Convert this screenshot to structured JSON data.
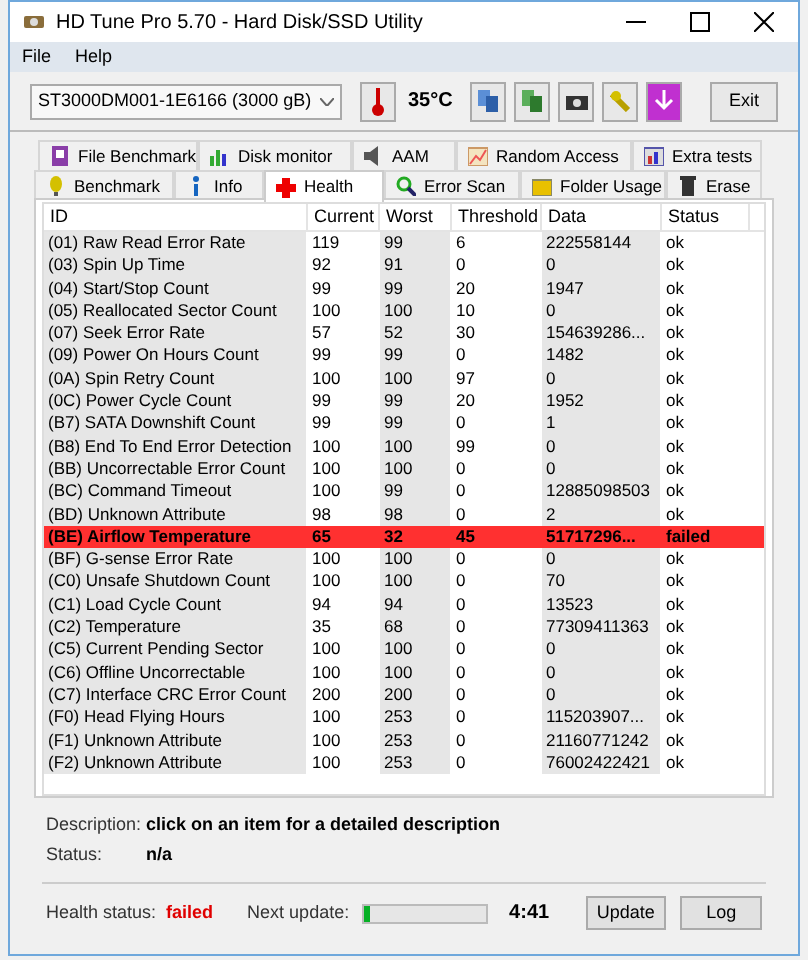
{
  "window": {
    "title": "HD Tune Pro 5.70 - Hard Disk/SSD Utility"
  },
  "menu": [
    "File",
    "Help"
  ],
  "drive": {
    "value": "ST3000DM001-1E6166 (3000 gB)"
  },
  "temperature": "35°C",
  "exit_button": "Exit",
  "tabs_top": [
    {
      "label": "File Benchmark",
      "selected": false
    },
    {
      "label": "Disk monitor",
      "selected": false
    },
    {
      "label": "AAM",
      "selected": false
    },
    {
      "label": "Random Access",
      "selected": false
    },
    {
      "label": "Extra tests",
      "selected": false
    }
  ],
  "tabs_bottom": [
    {
      "label": "Benchmark",
      "selected": false
    },
    {
      "label": "Info",
      "selected": false
    },
    {
      "label": "Health",
      "selected": true
    },
    {
      "label": "Error Scan",
      "selected": false
    },
    {
      "label": "Folder Usage",
      "selected": false
    },
    {
      "label": "Erase",
      "selected": false
    }
  ],
  "table": {
    "columns": [
      "ID",
      "Current",
      "Worst",
      "Threshold",
      "Data",
      "Status"
    ],
    "rows": [
      {
        "cells": [
          "(01) Raw Read Error Rate",
          "119",
          "99",
          "6",
          "222558144",
          "ok"
        ],
        "failed": false
      },
      {
        "cells": [
          "(03) Spin Up Time",
          "92",
          "91",
          "0",
          "0",
          "ok"
        ],
        "failed": false
      },
      {
        "cells": [
          "(04) Start/Stop Count",
          "99",
          "99",
          "20",
          "1947",
          "ok"
        ],
        "failed": false
      },
      {
        "cells": [
          "(05) Reallocated Sector Count",
          "100",
          "100",
          "10",
          "0",
          "ok"
        ],
        "failed": false
      },
      {
        "cells": [
          "(07) Seek Error Rate",
          "57",
          "52",
          "30",
          "154639286...",
          "ok"
        ],
        "failed": false
      },
      {
        "cells": [
          "(09) Power On Hours Count",
          "99",
          "99",
          "0",
          "1482",
          "ok"
        ],
        "failed": false
      },
      {
        "cells": [
          "(0A) Spin Retry Count",
          "100",
          "100",
          "97",
          "0",
          "ok"
        ],
        "failed": false
      },
      {
        "cells": [
          "(0C) Power Cycle Count",
          "99",
          "99",
          "20",
          "1952",
          "ok"
        ],
        "failed": false
      },
      {
        "cells": [
          "(B7) SATA Downshift Count",
          "99",
          "99",
          "0",
          "1",
          "ok"
        ],
        "failed": false
      },
      {
        "cells": [
          "(B8) End To End Error Detection",
          "100",
          "100",
          "99",
          "0",
          "ok"
        ],
        "failed": false
      },
      {
        "cells": [
          "(BB) Uncorrectable Error Count",
          "100",
          "100",
          "0",
          "0",
          "ok"
        ],
        "failed": false
      },
      {
        "cells": [
          "(BC) Command Timeout",
          "100",
          "99",
          "0",
          "12885098503",
          "ok"
        ],
        "failed": false
      },
      {
        "cells": [
          "(BD) Unknown Attribute",
          "98",
          "98",
          "0",
          "2",
          "ok"
        ],
        "failed": false
      },
      {
        "cells": [
          "(BE) Airflow Temperature",
          "65",
          "32",
          "45",
          "51717296...",
          "failed"
        ],
        "failed": true
      },
      {
        "cells": [
          "(BF) G-sense Error Rate",
          "100",
          "100",
          "0",
          "0",
          "ok"
        ],
        "failed": false
      },
      {
        "cells": [
          "(C0) Unsafe Shutdown Count",
          "100",
          "100",
          "0",
          "70",
          "ok"
        ],
        "failed": false
      },
      {
        "cells": [
          "(C1) Load Cycle Count",
          "94",
          "94",
          "0",
          "13523",
          "ok"
        ],
        "failed": false
      },
      {
        "cells": [
          "(C2) Temperature",
          "35",
          "68",
          "0",
          "77309411363",
          "ok"
        ],
        "failed": false
      },
      {
        "cells": [
          "(C5) Current Pending Sector",
          "100",
          "100",
          "0",
          "0",
          "ok"
        ],
        "failed": false
      },
      {
        "cells": [
          "(C6) Offline Uncorrectable",
          "100",
          "100",
          "0",
          "0",
          "ok"
        ],
        "failed": false
      },
      {
        "cells": [
          "(C7) Interface CRC Error Count",
          "200",
          "200",
          "0",
          "0",
          "ok"
        ],
        "failed": false
      },
      {
        "cells": [
          "(F0) Head Flying Hours",
          "100",
          "253",
          "0",
          "115203907...",
          "ok"
        ],
        "failed": false
      },
      {
        "cells": [
          "(F1) Unknown Attribute",
          "100",
          "253",
          "0",
          "21160771242",
          "ok"
        ],
        "failed": false
      },
      {
        "cells": [
          "(F2) Unknown Attribute",
          "100",
          "253",
          "0",
          "76002422421",
          "ok"
        ],
        "failed": false
      }
    ]
  },
  "description": {
    "label": "Description:",
    "value": "click on an item for a detailed description"
  },
  "status": {
    "label": "Status:",
    "value": "n/a"
  },
  "health_status": {
    "label": "Health status:",
    "value": "failed"
  },
  "next_update": {
    "label": "Next update:",
    "level": 0.05,
    "time": "4:41"
  },
  "buttons": [
    "Update",
    "Log"
  ]
}
